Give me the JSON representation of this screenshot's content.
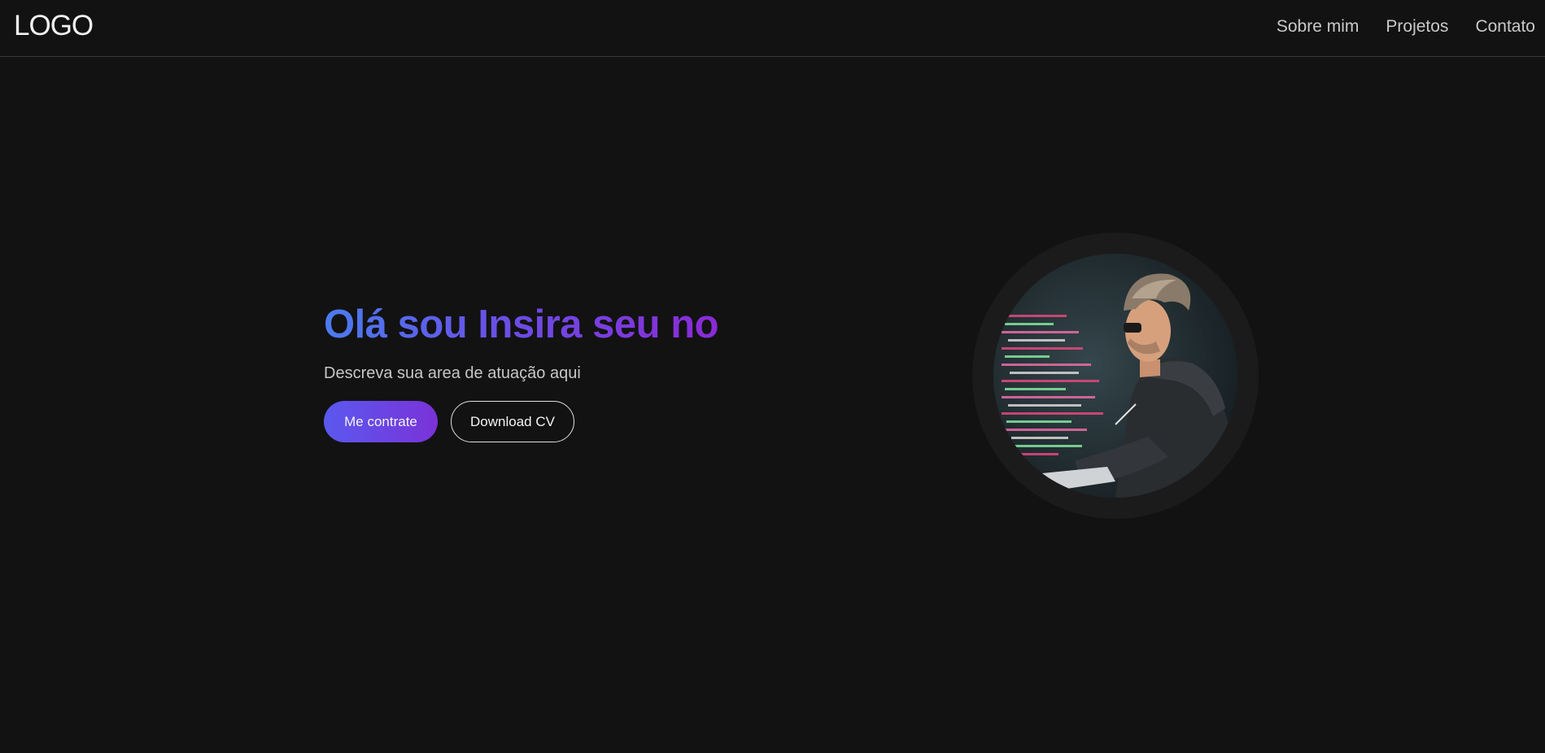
{
  "header": {
    "logo": "LOGO",
    "nav": [
      {
        "label": "Sobre mim"
      },
      {
        "label": "Projetos"
      },
      {
        "label": "Contato"
      }
    ]
  },
  "hero": {
    "title": "Olá sou Insira seu no",
    "subtitle": "Descreva sua area de atuação aqui",
    "primary_button": "Me contrate",
    "secondary_button": "Download CV"
  },
  "avatar": {
    "description": "illustration-developer-coding",
    "icon": "avatar-image"
  },
  "colors": {
    "background": "#121212",
    "gradient_start": "#4a7cf0",
    "gradient_end": "#8a2ad6",
    "button_start": "#5a59ee",
    "button_end": "#7a32d8"
  }
}
